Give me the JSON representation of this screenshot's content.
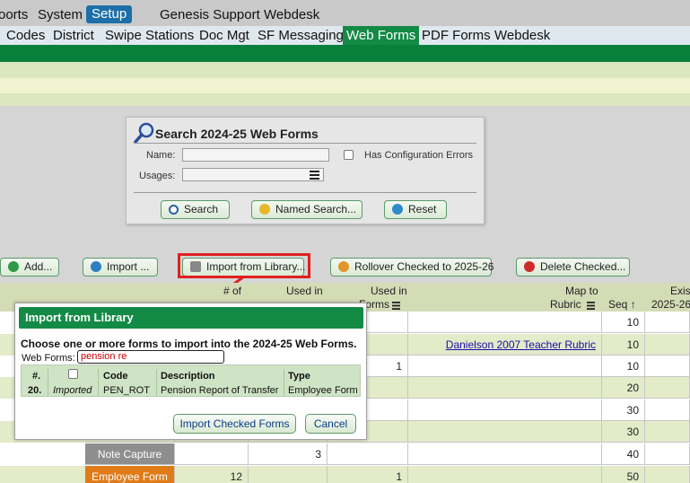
{
  "top_nav": {
    "items": [
      "oorts",
      "System",
      "Setup",
      "Genesis Support",
      "Webdesk"
    ],
    "active": "Setup"
  },
  "sub_nav": {
    "items": [
      "Codes",
      "District",
      "Swipe Stations",
      "Doc Mgt",
      "SF Messaging",
      "Web Forms",
      "PDF Forms",
      "Webdesk"
    ],
    "active": "Web Forms"
  },
  "search": {
    "title": "Search 2024-25 Web Forms",
    "name_label": "Name:",
    "name_value": "",
    "usages_label": "Usages:",
    "usages_value": "",
    "config_errors_label": "Has Configuration Errors",
    "buttons": {
      "search": "Search",
      "named_search": "Named Search...",
      "reset": "Reset"
    }
  },
  "actions": {
    "add": "Add...",
    "import": "Import ...",
    "import_from_library": "Import from Library...",
    "rollover": "Rollover Checked to 2025-26",
    "delete_checked": "Delete Checked..."
  },
  "grid": {
    "headers": {
      "frag_used": "# of",
      "used_in_1": "Used in",
      "used_in_2": "Used in",
      "forms": "Forms",
      "map_to": "Map to",
      "rubric": "Rubric",
      "seq": "Seq",
      "exist": "Exist",
      "exist2": "2025-26"
    },
    "rows": [
      {
        "type": "",
        "col_a": "",
        "col_b": "",
        "col_c": "",
        "rubric": "",
        "seq": "10"
      },
      {
        "type": "",
        "col_a": "",
        "col_b": "",
        "col_c": "",
        "rubric": "Danielson 2007 Teacher Rubric",
        "seq": "10"
      },
      {
        "type": "",
        "col_a": "",
        "col_b": "",
        "col_c": "1",
        "rubric": "",
        "seq": "10"
      },
      {
        "type": "",
        "col_a": "",
        "col_b": "",
        "col_c": "",
        "rubric": "",
        "seq": "20"
      },
      {
        "type": "",
        "col_a": "",
        "col_b": "",
        "col_c": "",
        "rubric": "",
        "seq": "30"
      },
      {
        "type": "",
        "col_a": "",
        "col_b": "",
        "col_c": "",
        "rubric": "",
        "seq": "30"
      },
      {
        "type": "Note Capture",
        "col_a": "",
        "col_b": "3",
        "col_c": "",
        "rubric": "",
        "seq": "40"
      },
      {
        "type": "Employee Form",
        "col_a": "12",
        "col_b": "",
        "col_c": "1",
        "rubric": "",
        "seq": "50"
      }
    ]
  },
  "modal": {
    "title": "Import from Library",
    "prompt": "Choose one or more forms to import into the 2024-25 Web Forms.",
    "web_forms_label": "Web Forms:",
    "web_forms_value": "pension re",
    "columns": {
      "num": "#.",
      "code": "Code",
      "description": "Description",
      "type": "Type"
    },
    "row": {
      "num": "20.",
      "status": "Imported",
      "code": "PEN_ROT",
      "description": "Pension Report of Transfer",
      "type": "Employee Form"
    },
    "import_button": "Import Checked Forms",
    "cancel_button": "Cancel"
  },
  "colors": {
    "accent_green": "#138a45",
    "nav_blue": "#1c6fa8",
    "highlight_red": "#e02020",
    "note_capture_bg": "#8e8e8e",
    "employee_form_bg": "#e07b18"
  }
}
